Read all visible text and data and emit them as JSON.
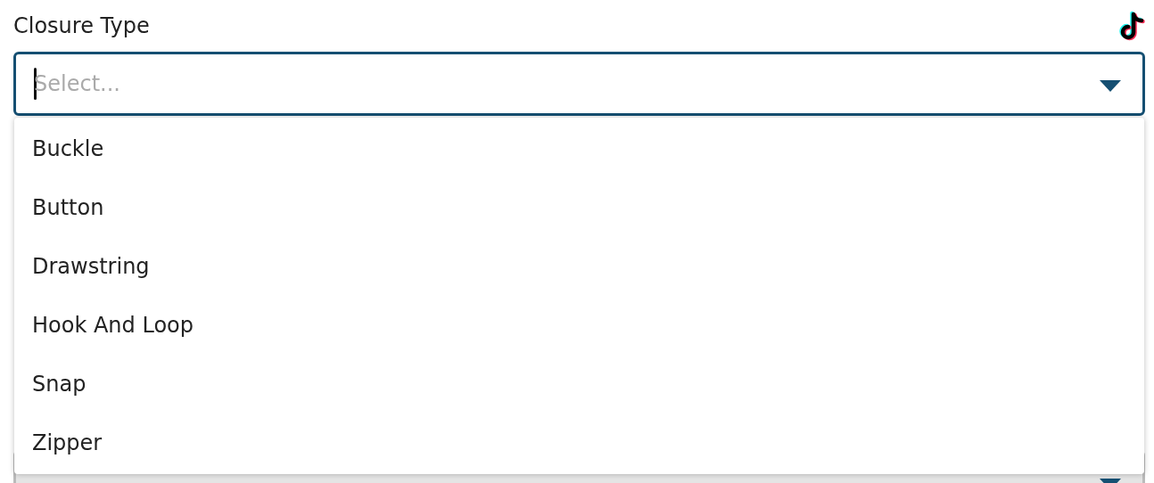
{
  "field": {
    "label": "Closure Type",
    "placeholder": "Select...",
    "expanded": true
  },
  "options": [
    {
      "label": "Buckle"
    },
    {
      "label": "Button"
    },
    {
      "label": "Drawstring"
    },
    {
      "label": "Hook And Loop"
    },
    {
      "label": "Snap"
    },
    {
      "label": "Zipper"
    }
  ]
}
